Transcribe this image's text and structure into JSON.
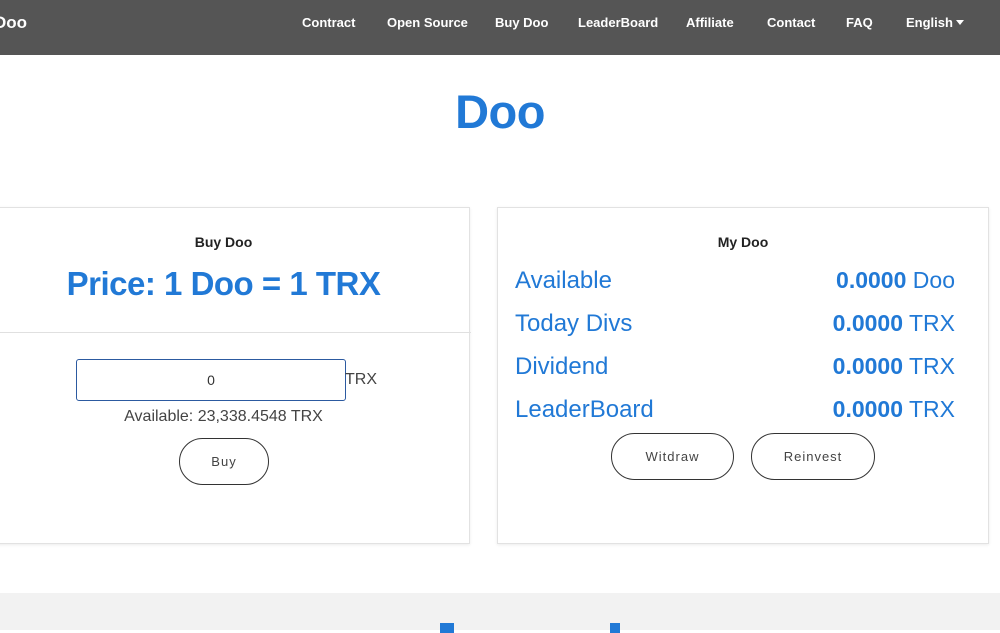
{
  "nav": {
    "brand": "Doo",
    "items": [
      {
        "label": "Contract"
      },
      {
        "label": "Open Source"
      },
      {
        "label": "Buy Doo"
      },
      {
        "label": "LeaderBoard"
      },
      {
        "label": "Affiliate"
      },
      {
        "label": "Contact"
      },
      {
        "label": "FAQ"
      },
      {
        "label": "English"
      }
    ]
  },
  "hero": {
    "title": "Doo"
  },
  "buy_panel": {
    "heading": "Buy Doo",
    "price": "Price: 1 Doo = 1 TRX",
    "input_value": "0",
    "currency": "TRX",
    "available": "Available: 23,338.4548 TRX",
    "buy_label": "Buy"
  },
  "my_panel": {
    "heading": "My Doo",
    "rows": [
      {
        "label": "Available",
        "amount": "0.0000",
        "unit": "Doo"
      },
      {
        "label": "Today Divs",
        "amount": "0.0000",
        "unit": "TRX"
      },
      {
        "label": "Dividend",
        "amount": "0.0000",
        "unit": "TRX"
      },
      {
        "label": "LeaderBoard",
        "amount": "0.0000",
        "unit": "TRX"
      }
    ],
    "withdraw_label": "Witdraw",
    "reinvest_label": "Reinvest"
  },
  "colors": {
    "accent": "#2179d6",
    "navbar": "#555555"
  },
  "icons": {
    "language_dropdown": "caret-down-icon"
  }
}
